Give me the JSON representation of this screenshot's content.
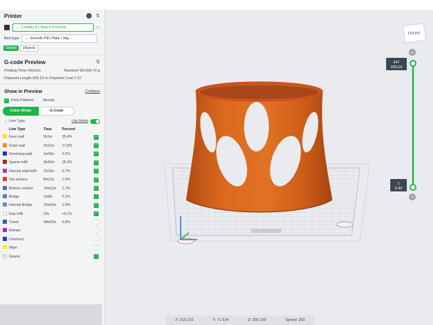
{
  "printer": {
    "title": "Printer",
    "printer_name": "Creality K1 Max 0.4 nozzle",
    "bed_type_label": "Bed type",
    "bed_type_value": "Smooth PEI Plate / Hig...",
    "tab_global": "Global",
    "tab_objects": "Objects"
  },
  "gcode": {
    "title": "G-code Preview",
    "printing_time": "Printing Time:14h11m",
    "filament_wt": "Filament Wt:504.70 g",
    "filament_length": "Filament Length:165.22 m",
    "filament_cost": "Filament Cost:7.07"
  },
  "show": {
    "title": "Show in Preview",
    "collapse": "Collapse",
    "print_platform": "Print Platform",
    "nozzle": "Nozzle",
    "color_show": "Color Show",
    "gcode": "G-Code",
    "line_type_dropdown": "Line Type",
    "lite_mode": "Lite Mode",
    "headers": [
      "Line Type",
      "Time",
      "Percent"
    ]
  },
  "line_types": [
    {
      "name": "Inner wall",
      "time": "5h1m",
      "percent": "35.4%",
      "color": "#f5e11c",
      "checked": true
    },
    {
      "name": "Outer wall",
      "time": "2h31m",
      "percent": "17.8%",
      "color": "#f08c2a",
      "checked": true
    },
    {
      "name": "Overhang wall",
      "time": "1m55s",
      "percent": "0.2%",
      "color": "#1e2ec9",
      "checked": true
    },
    {
      "name": "Sparse infill",
      "time": "3h43m",
      "percent": "26.3%",
      "color": "#a3272a",
      "checked": true
    },
    {
      "name": "Internal solid infill",
      "time": "1h23m",
      "percent": "9.7%",
      "color": "#a33bbd",
      "checked": true
    },
    {
      "name": "Top surface",
      "time": "8m13s",
      "percent": "1.0%",
      "color": "#e5363a",
      "checked": true
    },
    {
      "name": "Bottom surface",
      "time": "14m13s",
      "percent": "1.7%",
      "color": "#5e6ca8",
      "checked": true
    },
    {
      "name": "Bridge",
      "time": "1m8s",
      "percent": "0.1%",
      "color": "#4d83b5",
      "checked": true
    },
    {
      "name": "Internal Bridge",
      "time": "15m53s",
      "percent": "1.9%",
      "color": "#7a8ac2",
      "checked": true
    },
    {
      "name": "Gap infill",
      "time": "23s",
      "percent": "<0.1%",
      "color": "#ffffff",
      "checked": true
    },
    {
      "name": "Travel",
      "time": "49m20s",
      "percent": "5.8%",
      "color": "#2a66a8",
      "checked": false
    },
    {
      "name": "Retract",
      "time": "",
      "percent": "",
      "color": "#c41fc4",
      "checked": false
    },
    {
      "name": "Unretract",
      "time": "",
      "percent": "",
      "color": "#2540c2",
      "checked": false
    },
    {
      "name": "Wipe",
      "time": "",
      "percent": "",
      "color": "#f5f01c",
      "checked": false
    },
    {
      "name": "Seams",
      "time": "",
      "percent": "",
      "color": "#e8e8e8",
      "checked": true
    }
  ],
  "slider": {
    "top_line1": "447",
    "top_line2": "200.10",
    "bottom_line1": "1",
    "bottom_line2": "0.30"
  },
  "view_cube": {
    "label": "FRONT"
  },
  "status_bar": {
    "x": "X: 219.210",
    "y": "Y: 71.614",
    "z": "Z: 200.100",
    "speed": "Speed: 250"
  },
  "colors": {
    "accent": "#1fb449",
    "model_orange": "#d8641c",
    "viewport_bg": "#e9ebee"
  }
}
